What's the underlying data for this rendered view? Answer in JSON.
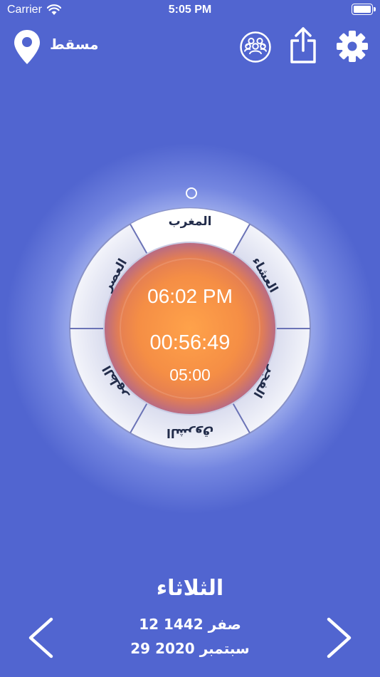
{
  "status_bar": {
    "carrier": "Carrier",
    "time": "5:05 PM"
  },
  "header": {
    "city": "مسقط",
    "location_icon": "location-pin-icon",
    "group_icon": "people-group-icon",
    "share_icon": "share-icon",
    "settings_icon": "gear-icon"
  },
  "dial": {
    "prayers": {
      "maghrib": "المغرب",
      "isha": "العشاء",
      "fajr": "الفجر",
      "sunrise": "الشروق",
      "dhuhr": "الظهر",
      "asr": "العصر"
    },
    "current_prayer_time": "06:02 PM",
    "countdown": "00:56:49",
    "secondary_time": "05:00"
  },
  "footer": {
    "day_name": "الثلاثاء",
    "hijri_date": "12 صفر 1442",
    "gregorian_date": "29 سبتمبر 2020"
  },
  "colors": {
    "background": "#5165d0",
    "center_orange": "#f5903e",
    "ring": "#e6e8f4"
  }
}
